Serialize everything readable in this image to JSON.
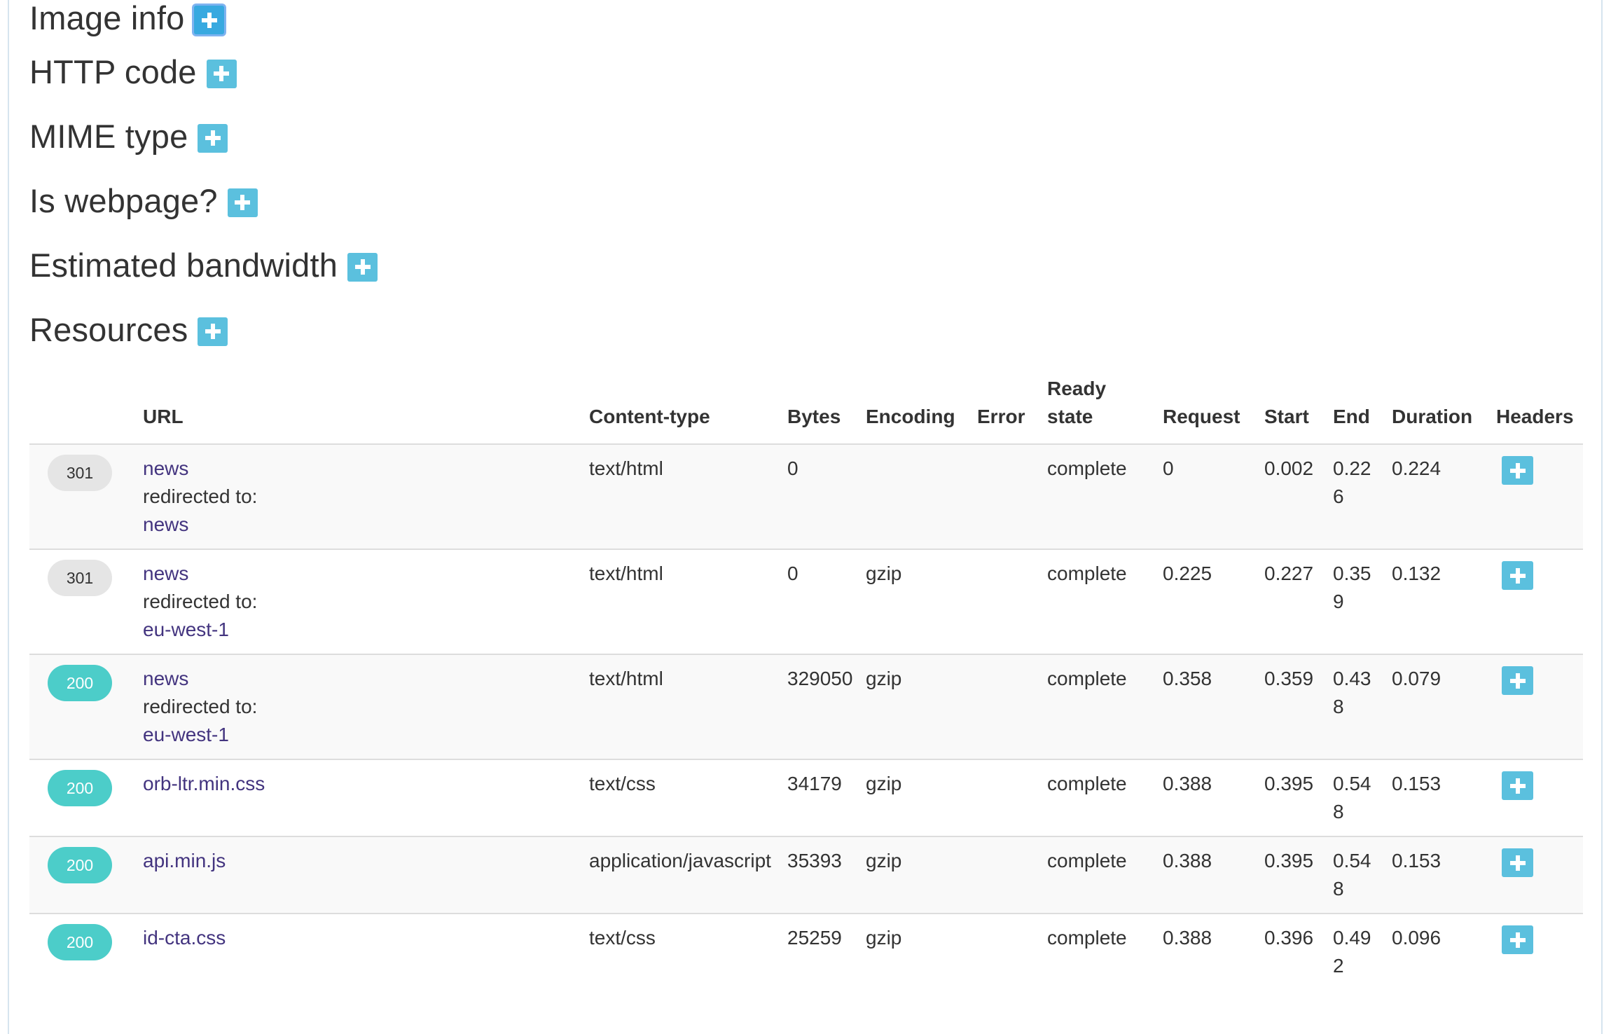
{
  "sections": [
    {
      "title": "Image info",
      "focused": true
    },
    {
      "title": "HTTP code",
      "focused": false
    },
    {
      "title": "MIME type",
      "focused": false
    },
    {
      "title": "Is webpage?",
      "focused": false
    },
    {
      "title": "Estimated bandwidth",
      "focused": false
    },
    {
      "title": "Resources",
      "focused": false
    }
  ],
  "table": {
    "headers": {
      "code": "",
      "url": "URL",
      "content_type": "Content-type",
      "bytes": "Bytes",
      "encoding": "Encoding",
      "error": "Error",
      "ready_state_line1": "Ready",
      "ready_state_line2": "state",
      "request": "Request",
      "start": "Start",
      "end": "End",
      "duration": "Duration",
      "headers": "Headers"
    },
    "redirect_label": "redirected to:",
    "rows": [
      {
        "code": "301",
        "status": "redirect",
        "url": "news",
        "redirect": "news",
        "content_type": "text/html",
        "bytes": "0",
        "encoding": "",
        "error": "",
        "ready_state": "complete",
        "request": "0",
        "start": "0.002",
        "end": "0.226",
        "duration": "0.224"
      },
      {
        "code": "301",
        "status": "redirect",
        "url": "news",
        "redirect": "eu-west-1",
        "content_type": "text/html",
        "bytes": "0",
        "encoding": "gzip",
        "error": "",
        "ready_state": "complete",
        "request": "0.225",
        "start": "0.227",
        "end": "0.359",
        "duration": "0.132"
      },
      {
        "code": "200",
        "status": "ok",
        "url": "news",
        "redirect": "eu-west-1",
        "content_type": "text/html",
        "bytes": "329050",
        "encoding": "gzip",
        "error": "",
        "ready_state": "complete",
        "request": "0.358",
        "start": "0.359",
        "end": "0.438",
        "duration": "0.079"
      },
      {
        "code": "200",
        "status": "ok",
        "url": "orb-ltr.min.css",
        "redirect": "",
        "content_type": "text/css",
        "bytes": "34179",
        "encoding": "gzip",
        "error": "",
        "ready_state": "complete",
        "request": "0.388",
        "start": "0.395",
        "end": "0.548",
        "duration": "0.153"
      },
      {
        "code": "200",
        "status": "ok",
        "url": "api.min.js",
        "redirect": "",
        "content_type": "application/javascript",
        "bytes": "35393",
        "encoding": "gzip",
        "error": "",
        "ready_state": "complete",
        "request": "0.388",
        "start": "0.395",
        "end": "0.548",
        "duration": "0.153"
      },
      {
        "code": "200",
        "status": "ok",
        "url": "id-cta.css",
        "redirect": "",
        "content_type": "text/css",
        "bytes": "25259",
        "encoding": "gzip",
        "error": "",
        "ready_state": "complete",
        "request": "0.388",
        "start": "0.396",
        "end": "0.492",
        "duration": "0.096"
      }
    ]
  },
  "colors": {
    "accent": "#5bc0de",
    "focused_accent": "#38a9e0",
    "badge_ok": "#4ccdc9",
    "badge_redirect": "#e5e5e5",
    "link": "#43347f"
  },
  "icons": {
    "section_toggle": "plus-icon",
    "row_headers_toggle": "plus-icon"
  }
}
